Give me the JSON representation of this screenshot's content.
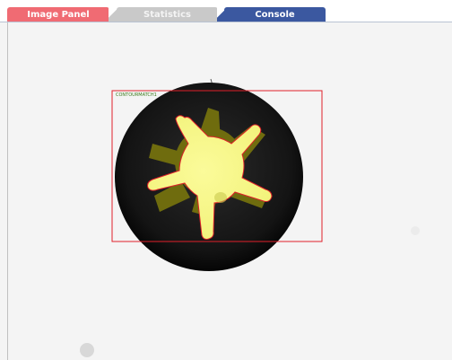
{
  "tabs": [
    {
      "label": "Image Panel",
      "active": false,
      "color": "#f06b73"
    },
    {
      "label": "Statistics",
      "active": false,
      "color": "#c9c9c9"
    },
    {
      "label": "Console",
      "active": true,
      "color": "#3b58a0"
    }
  ],
  "viewer": {
    "roi_label": "CONTOURMATCH1",
    "roi_color": "#e0202a",
    "match_contour_color": "#e0202a",
    "highlight_color": "#f7f78a",
    "olive_color": "#7f7a10"
  }
}
